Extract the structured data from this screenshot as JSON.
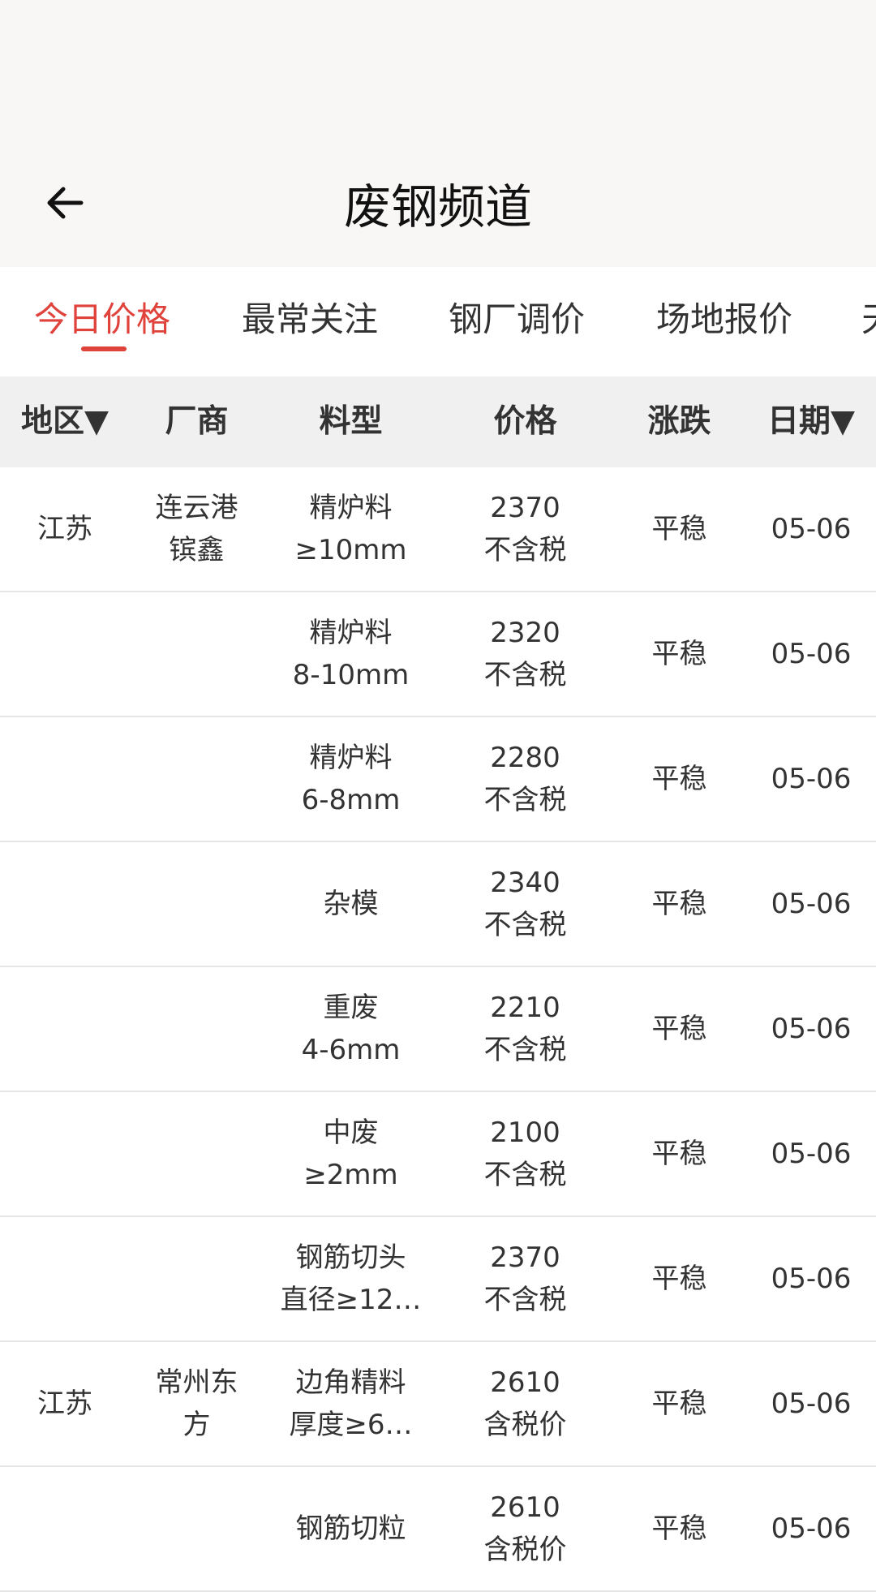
{
  "header": {
    "title": "废钢频道",
    "back_icon": "arrow-left-icon"
  },
  "tabs": [
    {
      "label": "今日价格",
      "active": true
    },
    {
      "label": "最常关注",
      "active": false
    },
    {
      "label": "钢厂调价",
      "active": false
    },
    {
      "label": "场地报价",
      "active": false
    },
    {
      "label": "天",
      "active": false
    }
  ],
  "accent_color": "#e0423c",
  "table": {
    "columns": [
      "地区▼",
      "厂商",
      "料型",
      "价格",
      "涨跌",
      "日期▼"
    ],
    "rows": [
      {
        "region": "江苏",
        "vendor1": "连云港",
        "vendor2": "镔鑫",
        "type1": "精炉料",
        "type2": "≥10mm",
        "price": "2370",
        "tax": "不含税",
        "trend": "平稳",
        "date": "05-06"
      },
      {
        "region": "",
        "vendor1": "",
        "vendor2": "",
        "type1": "精炉料",
        "type2": "8-10mm",
        "price": "2320",
        "tax": "不含税",
        "trend": "平稳",
        "date": "05-06"
      },
      {
        "region": "",
        "vendor1": "",
        "vendor2": "",
        "type1": "精炉料",
        "type2": "6-8mm",
        "price": "2280",
        "tax": "不含税",
        "trend": "平稳",
        "date": "05-06"
      },
      {
        "region": "",
        "vendor1": "",
        "vendor2": "",
        "type1": "杂模",
        "type2": "",
        "price": "2340",
        "tax": "不含税",
        "trend": "平稳",
        "date": "05-06"
      },
      {
        "region": "",
        "vendor1": "",
        "vendor2": "",
        "type1": "重废",
        "type2": "4-6mm",
        "price": "2210",
        "tax": "不含税",
        "trend": "平稳",
        "date": "05-06"
      },
      {
        "region": "",
        "vendor1": "",
        "vendor2": "",
        "type1": "中废",
        "type2": "≥2mm",
        "price": "2100",
        "tax": "不含税",
        "trend": "平稳",
        "date": "05-06"
      },
      {
        "region": "",
        "vendor1": "",
        "vendor2": "",
        "type1": "钢筋切头",
        "type2": "直径≥12…",
        "price": "2370",
        "tax": "不含税",
        "trend": "平稳",
        "date": "05-06"
      },
      {
        "region": "江苏",
        "vendor1": "常州东",
        "vendor2": "方",
        "type1": "边角精料",
        "type2": "厚度≥6…",
        "price": "2610",
        "tax": "含税价",
        "trend": "平稳",
        "date": "05-06"
      },
      {
        "region": "",
        "vendor1": "",
        "vendor2": "",
        "type1": "钢筋切粒",
        "type2": "",
        "price": "2610",
        "tax": "含税价",
        "trend": "平稳",
        "date": "05-06"
      }
    ]
  }
}
